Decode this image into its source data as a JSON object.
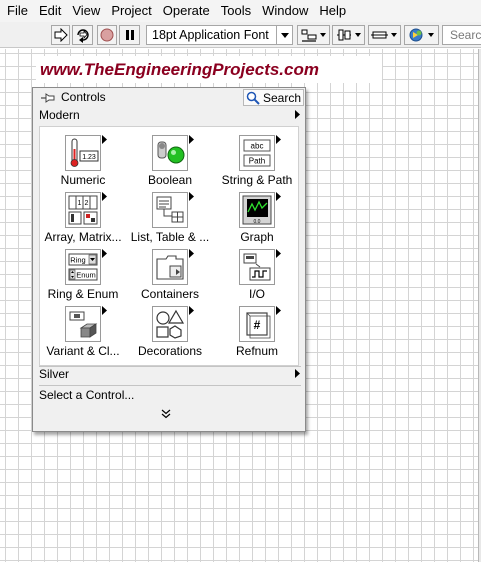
{
  "menu": [
    "File",
    "Edit",
    "View",
    "Project",
    "Operate",
    "Tools",
    "Window",
    "Help"
  ],
  "toolbar": {
    "font": "18pt Application Font",
    "search_placeholder": "Search"
  },
  "banner": {
    "text": "www.TheEngineeringProjects.com"
  },
  "palette": {
    "title": "Controls",
    "search_label": "Search",
    "category_modern": "Modern",
    "category_silver": "Silver",
    "select_control": "Select a Control...",
    "tiles": [
      {
        "label": "Numeric",
        "icon": "numeric-icon"
      },
      {
        "label": "Boolean",
        "icon": "boolean-icon"
      },
      {
        "label": "String & Path",
        "icon": "string-path-icon"
      },
      {
        "label": "Array, Matrix...",
        "icon": "array-matrix-icon"
      },
      {
        "label": "List, Table & ...",
        "icon": "list-table-icon"
      },
      {
        "label": "Graph",
        "icon": "graph-icon"
      },
      {
        "label": "Ring & Enum",
        "icon": "ring-enum-icon"
      },
      {
        "label": "Containers",
        "icon": "containers-icon"
      },
      {
        "label": "I/O",
        "icon": "io-icon"
      },
      {
        "label": "Variant & Cl...",
        "icon": "variant-class-icon"
      },
      {
        "label": "Decorations",
        "icon": "decorations-icon"
      },
      {
        "label": "Refnum",
        "icon": "refnum-icon"
      }
    ],
    "icon_text": {
      "numeric": "1.23",
      "string_abc": "abc",
      "string_path": "Path",
      "array_digits": "1 2 3 4",
      "ring": "Ring",
      "enum": "Enum",
      "graph_axis": "0.0",
      "refnum": "#"
    }
  }
}
